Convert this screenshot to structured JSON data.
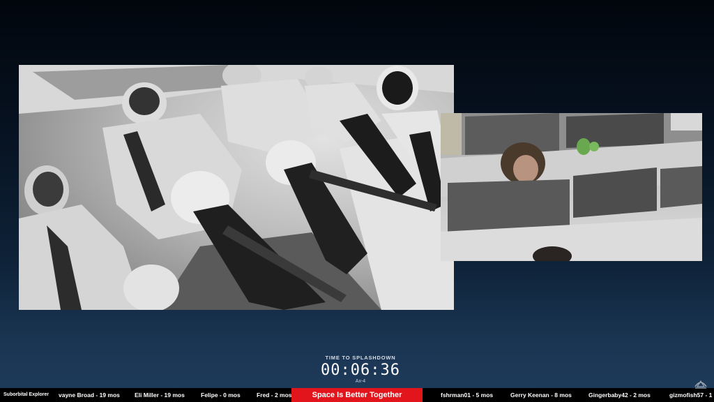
{
  "countdown": {
    "label": "TIME TO SPLASHDOWN",
    "time": "00:06:36",
    "mission": "Ax-4"
  },
  "ticker": {
    "tier": "Suborbital Explorer",
    "items": [
      "vayne Broad - 19 mos",
      "Eli Miller - 19 mos",
      "Felipe - 0 mos",
      "Fred - 2 mos",
      "fshrman01 - 5 mos",
      "Gerry Keenan - 8 mos",
      "Gingerbaby42 - 2 mos",
      "gizmofish57 - 1"
    ],
    "banner": "Space Is Better Together"
  },
  "icons": {
    "logo": "spacex-logo-icon"
  },
  "colors": {
    "banner": "#e2141c",
    "ticker_bg": "#000000",
    "background_top": "#01060d",
    "background_bottom": "#203c5c"
  }
}
